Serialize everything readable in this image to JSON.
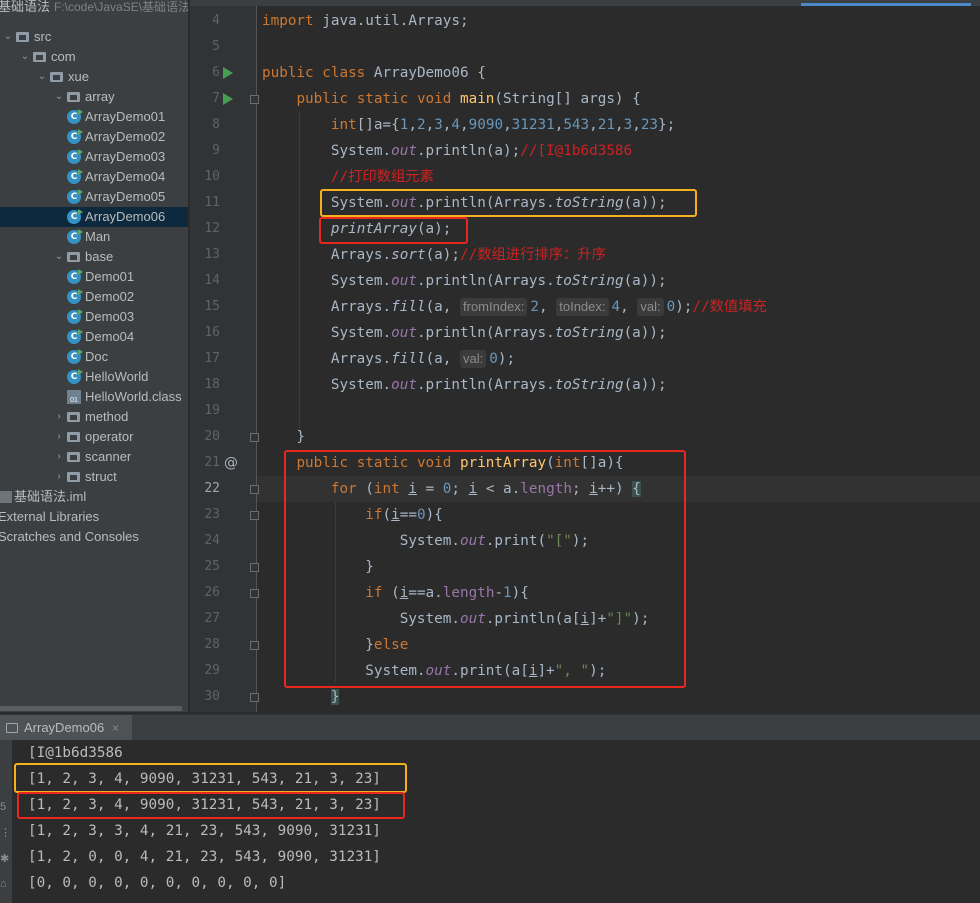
{
  "project": {
    "root_label": "基础语法",
    "root_path": "F:\\code\\JavaSE\\基础语法",
    "items": [
      {
        "label": "src",
        "kind": "folder",
        "level": 0
      },
      {
        "label": "com",
        "kind": "package",
        "level": 1
      },
      {
        "label": "xue",
        "kind": "package",
        "level": 2
      },
      {
        "label": "array",
        "kind": "package",
        "level": 3
      },
      {
        "label": "ArrayDemo01",
        "kind": "class",
        "level": 4
      },
      {
        "label": "ArrayDemo02",
        "kind": "class",
        "level": 4
      },
      {
        "label": "ArrayDemo03",
        "kind": "class",
        "level": 4
      },
      {
        "label": "ArrayDemo04",
        "kind": "class",
        "level": 4
      },
      {
        "label": "ArrayDemo05",
        "kind": "class",
        "level": 4
      },
      {
        "label": "ArrayDemo06",
        "kind": "class",
        "level": 4,
        "selected": true
      },
      {
        "label": "Man",
        "kind": "class",
        "level": 4
      },
      {
        "label": "base",
        "kind": "package",
        "level": 3
      },
      {
        "label": "Demo01",
        "kind": "class",
        "level": 4
      },
      {
        "label": "Demo02",
        "kind": "class",
        "level": 4
      },
      {
        "label": "Demo03",
        "kind": "class",
        "level": 4
      },
      {
        "label": "Demo04",
        "kind": "class",
        "level": 4
      },
      {
        "label": "Doc",
        "kind": "class",
        "level": 4
      },
      {
        "label": "HelloWorld",
        "kind": "class",
        "level": 4
      },
      {
        "label": "HelloWorld.class",
        "kind": "classfile",
        "level": 4
      },
      {
        "label": "method",
        "kind": "package",
        "level": 3
      },
      {
        "label": "operator",
        "kind": "package",
        "level": 3
      },
      {
        "label": "scanner",
        "kind": "package",
        "level": 3
      },
      {
        "label": "struct",
        "kind": "package",
        "level": 3
      }
    ],
    "iml": "基础语法.iml",
    "external_libraries": "External Libraries",
    "scratches": "Scratches and Consoles"
  },
  "editor": {
    "line_numbers": [
      "4",
      "5",
      "6",
      "7",
      "8",
      "9",
      "10",
      "11",
      "12",
      "13",
      "14",
      "15",
      "16",
      "17",
      "18",
      "19",
      "20",
      "21",
      "22",
      "23",
      "24",
      "25",
      "26",
      "27",
      "28",
      "29",
      "30"
    ],
    "hints": {
      "fromIndex": "fromIndex:",
      "toIndex": "toIndex:",
      "val": "val:"
    },
    "comments": {
      "hash": "//[I@1b6d3586",
      "print_elements": "//打印数组元素",
      "sort": "//数组进行排序：升序",
      "fill": "//数值填充"
    },
    "current_line": "22"
  },
  "run": {
    "tab_label": "ArrayDemo06",
    "output": [
      "[I@1b6d3586",
      "[1, 2, 3, 4, 9090, 31231, 543, 21, 3, 23]",
      "[1, 2, 3, 4, 9090, 31231, 543, 21, 3, 23]",
      "[1, 2, 3, 3, 4, 21, 23, 543, 9090, 31231]",
      "[1, 2, 0, 0, 4, 21, 23, 543, 9090, 31231]",
      "[0, 0, 0, 0, 0, 0, 0, 0, 0, 0]"
    ]
  },
  "colors": {
    "keyword": "#cc7832",
    "method_decl": "#ffc66d",
    "number": "#6897bb",
    "string": "#6a8759",
    "field": "#9876aa",
    "comment": "#cc2222",
    "highlight_orange": "#f5b020",
    "highlight_red": "#e8271f"
  }
}
